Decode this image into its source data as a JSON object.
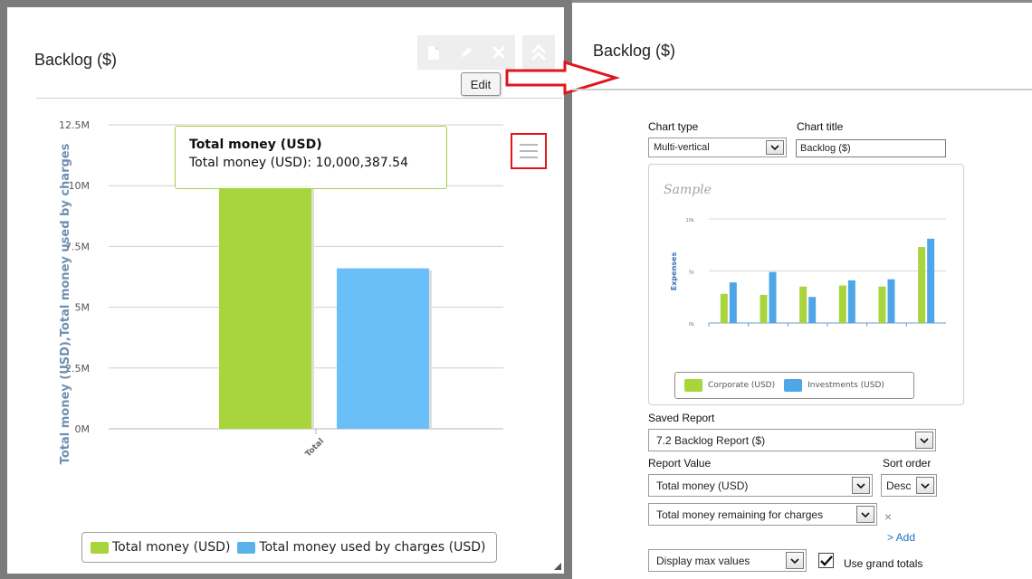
{
  "left_widget": {
    "title": "Backlog ($)",
    "edit_tooltip": "Edit",
    "chart_tooltip": {
      "title": "Total money (USD)",
      "body": "Total money (USD): 10,000,387.54"
    },
    "icons": [
      "document-icon",
      "pencil-icon",
      "close-icon",
      "collapse-up-icon",
      "hamburger-menu-icon"
    ]
  },
  "chart_data": {
    "type": "bar",
    "categories": [
      "Total"
    ],
    "series": [
      {
        "name": "Total money (USD)",
        "values": [
          10000387.54
        ],
        "color": "#a8d43c"
      },
      {
        "name": "Total money used by charges (USD)",
        "values": [
          6600000
        ],
        "color": "#6bbff8"
      }
    ],
    "ylabel": "Total money (USD),Total money used by charges",
    "yticks": [
      "0M",
      "2.5M",
      "5M",
      "7.5M",
      "10M",
      "12.5M"
    ],
    "ylim": [
      0,
      12500000
    ],
    "grid": true,
    "legend": "bottom"
  },
  "right_panel": {
    "title": "Backlog ($)",
    "chart_type_label": "Chart type",
    "chart_type_value": "Multi-vertical",
    "chart_title_label": "Chart title",
    "chart_title_value": "Backlog ($)",
    "sample": {
      "label": "Sample",
      "ylabel": "Expenses",
      "yticks": [
        "0k",
        "5k",
        "10k"
      ],
      "series": [
        {
          "name": "Corporate (USD)",
          "values": [
            2800,
            2700,
            3500,
            3600,
            3500,
            7300
          ],
          "color": "#a8d43c"
        },
        {
          "name": "Investments (USD)",
          "values": [
            3900,
            4900,
            2500,
            4100,
            4200,
            8100
          ],
          "color": "#4ea6e8"
        }
      ]
    },
    "saved_report_label": "Saved Report",
    "saved_report_value": "7.2 Backlog Report ($)",
    "report_value_label": "Report Value",
    "report_value_1": "Total money (USD)",
    "sort_order_label": "Sort order",
    "sort_order_value": "Desc",
    "report_value_2": "Total money remaining for charges",
    "remove_glyph": "×",
    "add_link": "> Add",
    "display_value": "Display max values",
    "grand_totals_label": "Use grand totals"
  }
}
